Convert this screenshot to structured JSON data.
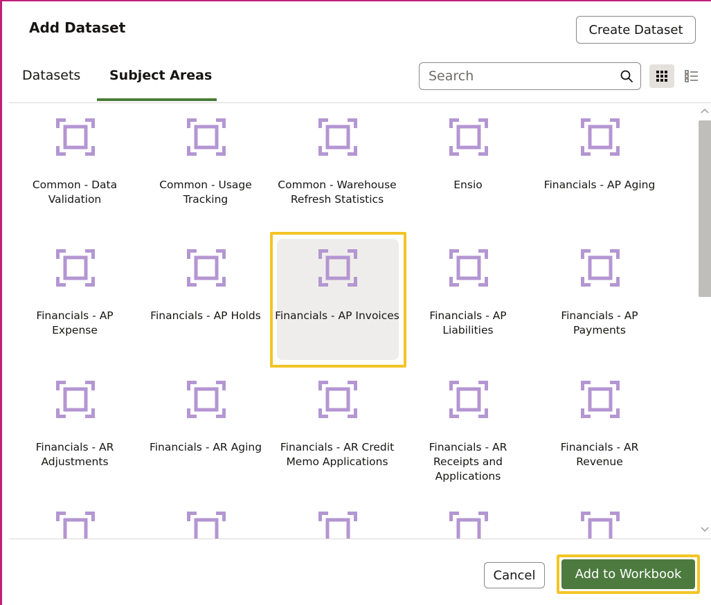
{
  "dialog": {
    "title": "Add Dataset",
    "create_button": "Create Dataset"
  },
  "tabs": [
    {
      "label": "Datasets",
      "active": false
    },
    {
      "label": "Subject Areas",
      "active": true
    }
  ],
  "search": {
    "placeholder": "Search",
    "value": ""
  },
  "view_modes": {
    "selected": "grid",
    "options": [
      "grid",
      "list"
    ]
  },
  "colors": {
    "accent_green": "#4d7b3f",
    "icon_purple": "#b496d2",
    "highlight_yellow": "#f3c425",
    "tab_underline": "#4a7c3a"
  },
  "tiles": [
    {
      "label": "Common - Data Validation",
      "icon": "subject-area-icon"
    },
    {
      "label": "Common - Usage Tracking",
      "icon": "subject-area-icon"
    },
    {
      "label": "Common - Warehouse Refresh Statistics",
      "icon": "subject-area-icon"
    },
    {
      "label": "Ensio",
      "icon": "subject-area-icon"
    },
    {
      "label": "Financials - AP Aging",
      "icon": "subject-area-icon"
    },
    {
      "label": "Financials - AP Expense",
      "icon": "subject-area-icon"
    },
    {
      "label": "Financials - AP Holds",
      "icon": "subject-area-icon"
    },
    {
      "label": "Financials - AP Invoices",
      "icon": "subject-area-icon",
      "selected": true
    },
    {
      "label": "Financials - AP Liabilities",
      "icon": "subject-area-icon"
    },
    {
      "label": "Financials - AP Payments",
      "icon": "subject-area-icon"
    },
    {
      "label": "Financials - AR Adjustments",
      "icon": "subject-area-icon"
    },
    {
      "label": "Financials - AR Aging",
      "icon": "subject-area-icon"
    },
    {
      "label": "Financials - AR Credit Memo Applications",
      "icon": "subject-area-icon"
    },
    {
      "label": "Financials - AR Receipts and Applications",
      "icon": "subject-area-icon"
    },
    {
      "label": "Financials - AR Revenue",
      "icon": "subject-area-icon"
    },
    {
      "label": "",
      "icon": "subject-area-icon"
    },
    {
      "label": "",
      "icon": "subject-area-icon"
    },
    {
      "label": "",
      "icon": "subject-area-icon"
    },
    {
      "label": "",
      "icon": "subject-area-icon"
    },
    {
      "label": "",
      "icon": "subject-area-icon"
    }
  ],
  "footer": {
    "cancel_label": "Cancel",
    "add_label": "Add to Workbook"
  }
}
